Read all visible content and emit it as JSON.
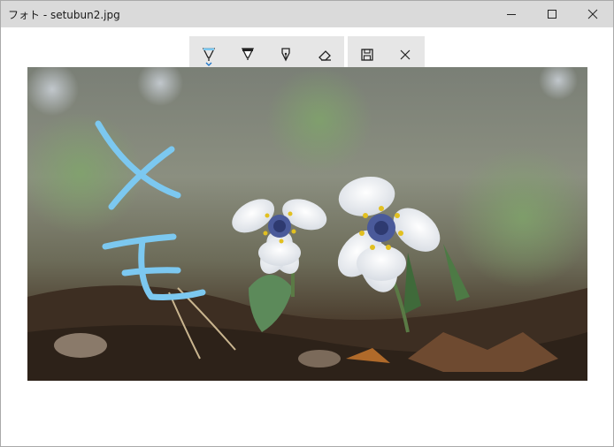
{
  "window": {
    "title": "フォト - setubun2.jpg"
  },
  "caption_buttons": [
    "minimize-icon",
    "maximize-icon",
    "close-icon"
  ],
  "ink_toolbar": {
    "tools": [
      {
        "name": "ballpoint-pen",
        "icon": "ballpoint-pen-icon",
        "selected": true
      },
      {
        "name": "pencil",
        "icon": "pencil-icon",
        "selected": false
      },
      {
        "name": "calligraphy-pen",
        "icon": "calligraphy-pen-icon",
        "selected": false
      },
      {
        "name": "eraser",
        "icon": "eraser-icon",
        "selected": false
      }
    ]
  },
  "action_toolbar": {
    "buttons": [
      {
        "name": "save-copy",
        "icon": "save-icon"
      },
      {
        "name": "close-ink",
        "icon": "close-icon"
      }
    ]
  },
  "colors": {
    "titlebar": "#dadada",
    "toolbar": "#e6e6e6",
    "accent": "#1a73c8",
    "ink": "#7cc8f0"
  }
}
